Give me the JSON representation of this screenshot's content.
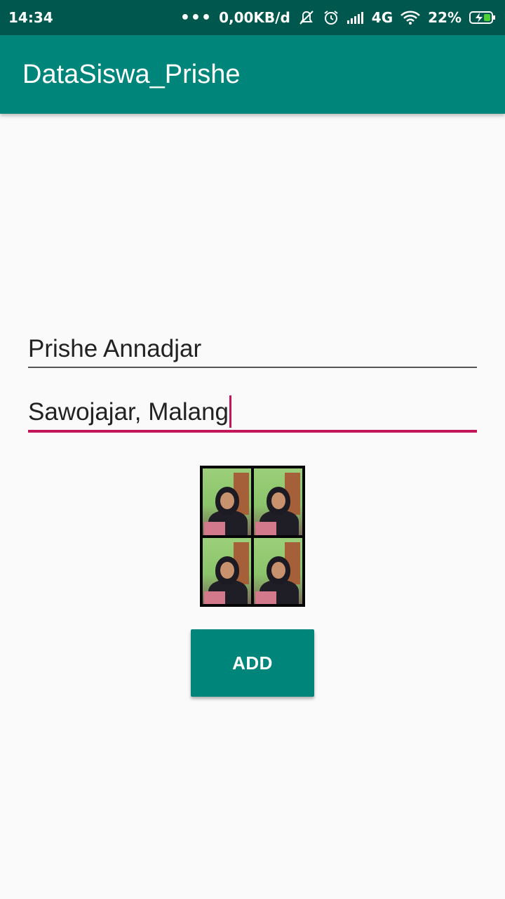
{
  "status_bar": {
    "time": "14:34",
    "more": "•••",
    "speed": "0,00KB/d",
    "network": "4G",
    "battery": "22%",
    "icons": [
      "mute-icon",
      "alarm-icon",
      "signal-icon",
      "wifi-icon",
      "battery-charging-icon"
    ]
  },
  "app_bar": {
    "title": "DataSiswa_Prishe",
    "color": "#00857a"
  },
  "form": {
    "name_value": "Prishe Annadjar",
    "address_value": "Sawojajar, Malang",
    "focus_color": "#c2185b"
  },
  "photo": {
    "description_icon": "student-photo-grid"
  },
  "actions": {
    "add_label": "ADD"
  }
}
